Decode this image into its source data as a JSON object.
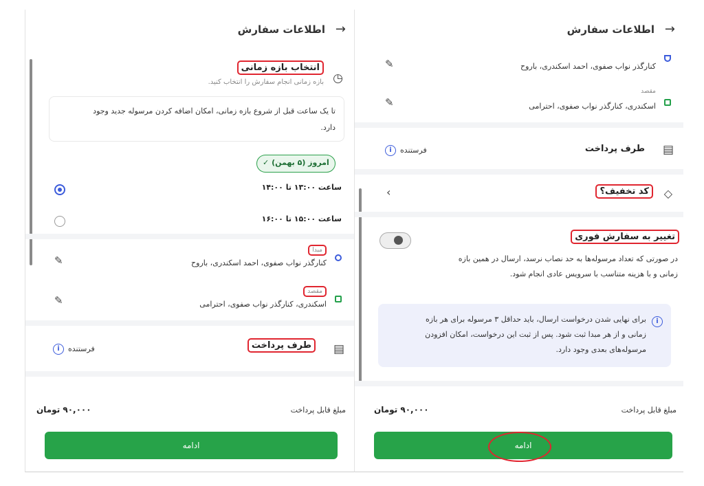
{
  "left": {
    "header": {
      "title": "اطلاعات سفارش",
      "back": "→"
    },
    "time_section": {
      "title": "انتخاب بازه زمانی",
      "subtitle": "بازه زمانی انجام سفارش را انتخاب کنید.",
      "note_line1": "تا یک ساعت قبل از شروع بازه زمانی، امکان اضافه کردن مرسوله جدید وجود",
      "note_line2": "دارد.",
      "day_chip": "امروز (۵ بهمن)",
      "slots": [
        {
          "label": "ساعت ۱۳:۰۰ تا ۱۴:۰۰",
          "selected": true
        },
        {
          "label": "ساعت ۱۵:۰۰ تا ۱۶:۰۰",
          "selected": false
        }
      ]
    },
    "route": {
      "origin_label": "مبدا",
      "origin_address": "کنارگذر نواب صفوی، احمد اسکندری، باروح",
      "dest_label": "مقصد",
      "dest_address": "اسکندری، کنارگذر نواب صفوی، احترامی"
    },
    "payment": {
      "title": "طرف پرداخت",
      "value": "فرستنده"
    },
    "total": {
      "label": "مبلغ قابل پرداخت",
      "amount": "۹۰,۰۰۰ تومان"
    },
    "cta": "ادامه"
  },
  "right": {
    "header": {
      "title": "اطلاعات سفارش",
      "back": "→"
    },
    "route": {
      "origin_address": "کنارگذر نواب صفوی، احمد اسکندری، باروح",
      "dest_label": "مقصد",
      "dest_address": "اسکندری، کنارگذر نواب صفوی، احترامی"
    },
    "payment": {
      "title": "طرف پرداخت",
      "value": "فرستنده"
    },
    "discount": {
      "title": "کد تخفیف؟"
    },
    "instant": {
      "title": "تغییر به سفارش فوری",
      "desc_line1": "در صورتی که تعداد مرسوله‌ها به حد نصاب نرسد، ارسال در همین بازه",
      "desc_line2": "زمانی و با هزینه متناسب با سرویس عادی انجام شود.",
      "toggle_on": false
    },
    "info": {
      "line1": "برای نهایی شدن درخواست ارسال، باید حداقل ۳ مرسوله برای هر بازه",
      "line2": "زمانی و از هر مبدا ثبت شود. پس از ثبت این درخواست، امکان افزودن",
      "line3": "مرسوله‌های بعدی وجود دارد."
    },
    "total": {
      "label": "مبلغ قابل پرداخت",
      "amount": "۹۰,۰۰۰ تومان"
    },
    "cta": "ادامه"
  }
}
